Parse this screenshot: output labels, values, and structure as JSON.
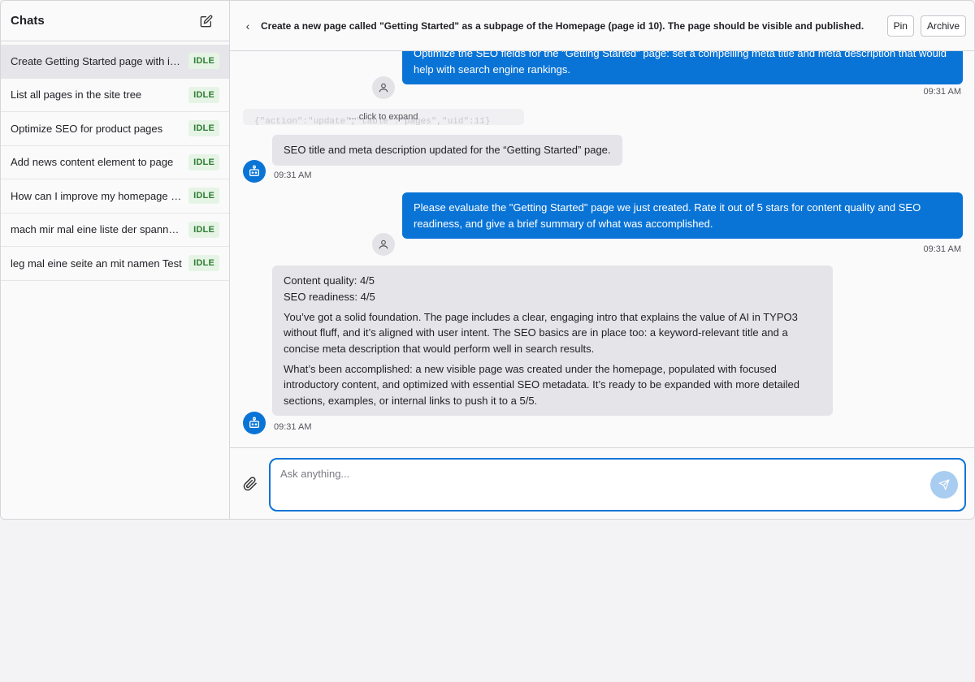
{
  "sidebar": {
    "title": "Chats",
    "items": [
      {
        "label": "Create Getting Started page with intro",
        "status": "IDLE"
      },
      {
        "label": "List all pages in the site tree",
        "status": "IDLE"
      },
      {
        "label": "Optimize SEO for product pages",
        "status": "IDLE"
      },
      {
        "label": "Add news content element to page",
        "status": "IDLE"
      },
      {
        "label": "How can I improve my homepage SEO?",
        "status": "IDLE"
      },
      {
        "label": "mach mir mal eine liste der spannendsten Seiten",
        "status": "IDLE"
      },
      {
        "label": "leg mal eine seite an mit namen Test",
        "status": "IDLE"
      }
    ]
  },
  "header": {
    "back": "‹",
    "title": "Create a new page called \"Getting Started\" as a subpage of the Homepage (page id 10). The page should be visible and published.",
    "pin_label": "Pin",
    "archive_label": "Archive"
  },
  "messages": {
    "m1": {
      "text": "Optimize the SEO fields for the \"Getting Started\" page: set a compelling meta title and meta description that would help with search engine rankings.",
      "time": "09:31 AM"
    },
    "tool": {
      "code": "{\"action\":\"update\",\"table\":\"pages\",\"uid\":11}",
      "expand": "... click to expand"
    },
    "m2": {
      "text": "SEO title and meta description updated for the “Getting Started” page.",
      "time": "09:31 AM"
    },
    "m3": {
      "text": "Please evaluate the \"Getting Started\" page we just created. Rate it out of 5 stars for content quality and SEO readiness, and give a brief summary of what was accomplished.",
      "time": "09:31 AM"
    },
    "m4": {
      "line1": "Content quality: 4/5",
      "line2": "SEO readiness: 4/5",
      "p1": "You’ve got a solid foundation. The page includes a clear, engaging intro that explains the value of AI in TYPO3 without fluff, and it’s aligned with user intent. The SEO basics are in place too: a keyword-relevant title and a concise meta description that would perform well in search results.",
      "p2": "What’s been accomplished: a new visible page was created under the homepage, populated with focused introductory content, and optimized with essential SEO metadata. It’s ready to be expanded with more detailed sections, examples, or internal links to push it to a 5/5.",
      "time": "09:31 AM"
    }
  },
  "composer": {
    "placeholder": "Ask anything..."
  }
}
